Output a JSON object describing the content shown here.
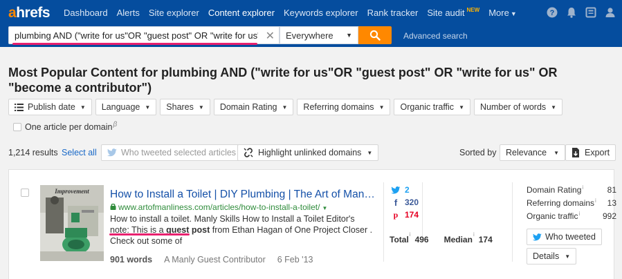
{
  "brand": {
    "logo_a": "a",
    "logo_rest": "hrefs",
    "accent_color": "#ff8800",
    "nav_bg_color": "#054d9e",
    "highlight_underline_color": "#e8206e"
  },
  "nav": {
    "items": [
      {
        "label": "Dashboard"
      },
      {
        "label": "Alerts"
      },
      {
        "label": "Site explorer"
      },
      {
        "label": "Content explorer"
      },
      {
        "label": "Keywords explorer"
      },
      {
        "label": "Rank tracker"
      },
      {
        "label": "Site audit",
        "badge": "NEW"
      },
      {
        "label": "More"
      }
    ],
    "icons": [
      "help-icon",
      "bell-icon",
      "news-icon",
      "user-icon"
    ]
  },
  "search": {
    "query": "plumbing AND (\"write for us\"OR \"guest post\" OR \"write for us\" OR \"become a contributor\")",
    "scope": "Everywhere",
    "advanced_label": "Advanced search"
  },
  "page": {
    "title": "Most Popular Content for plumbing AND (\"write for us\"OR \"guest post\" OR \"write for us\" OR \"become a contributor\")"
  },
  "filters": {
    "items": [
      {
        "label": "Publish date"
      },
      {
        "label": "Language"
      },
      {
        "label": "Shares"
      },
      {
        "label": "Domain Rating"
      },
      {
        "label": "Referring domains"
      },
      {
        "label": "Organic traffic"
      },
      {
        "label": "Number of words"
      }
    ],
    "one_article_label": "One article per domain",
    "beta_mark": "β"
  },
  "results_bar": {
    "count": "1,214 results",
    "select_all": "Select all",
    "who_tweeted_selected": "Who tweeted selected articles",
    "highlight_unlinked": "Highlight unlinked domains",
    "sorted_by_label": "Sorted by",
    "sort_value": "Relevance",
    "export_label": "Export"
  },
  "result": {
    "title": "How to Install a Toilet | DIY Plumbing | The Art of Manliness",
    "url": "www.artofmanliness.com/articles/how-to-install-a-toilet/",
    "snippet_part1": "How to install a toilet. Manly Skills How to Install a Toilet Editor's note: This is a ",
    "snippet_bold": "guest post",
    "snippet_part2": " from Ethan Hagan of One Project Closer . Check out some of",
    "words": "901 words",
    "author": "A Manly Guest Contributor",
    "date": "6 Feb '13",
    "social": {
      "twitter": "2",
      "facebook": "320",
      "pinterest": "174"
    },
    "total_label": "Total",
    "total_value": "496",
    "median_label": "Median",
    "median_value": "174",
    "metrics": [
      {
        "label": "Domain Rating",
        "value": "81"
      },
      {
        "label": "Referring domains",
        "value": "13"
      },
      {
        "label": "Organic traffic",
        "value": "992"
      }
    ],
    "who_tweeted_label": "Who tweeted",
    "details_label": "Details",
    "thumbnail_caption": "Improvement"
  }
}
